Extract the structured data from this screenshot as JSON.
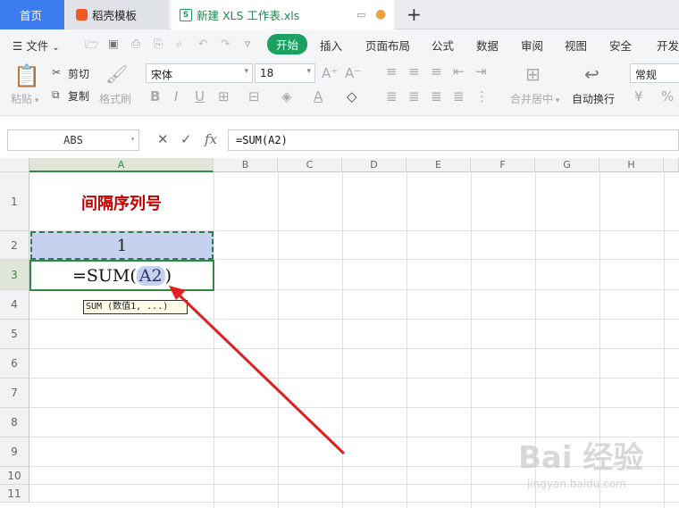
{
  "tabs": {
    "home": "首页",
    "docer": "稻壳模板",
    "doc": "新建 XLS 工作表.xls",
    "add_icon": "plus-icon",
    "xls_logo": "S"
  },
  "menu": {
    "file": "文件",
    "items": [
      "开始",
      "插入",
      "页面布局",
      "公式",
      "数据",
      "审阅",
      "视图",
      "安全",
      "开发"
    ]
  },
  "ribbon": {
    "paste": "粘贴",
    "cut": "剪切",
    "copy": "复制",
    "format_painter": "格式刷",
    "font_name": "宋体",
    "font_size": "18",
    "merge_center": "合并居中",
    "wrap_text": "自动换行",
    "number_format": "常规"
  },
  "formula_bar": {
    "name_box": "ABS",
    "fx": "fx",
    "formula": "=SUM(A2)"
  },
  "sheet": {
    "columns": [
      "A",
      "B",
      "C",
      "D",
      "E",
      "F",
      "G",
      "H"
    ],
    "rows": [
      "1",
      "2",
      "3",
      "4",
      "5",
      "6",
      "7",
      "8",
      "9",
      "10",
      "11"
    ],
    "a1": "间隔序列号",
    "a2": "1",
    "a3_prefix": "=SUM(",
    "a3_ref": "A2",
    "a3_suffix": ")",
    "tooltip": "SUM (数值1, ...)"
  },
  "colors": {
    "accent": "#1aa061",
    "home_tab": "#3b7cf0",
    "title_red": "#c00000",
    "selection": "#c5d1ee",
    "arrow": "#e02020"
  },
  "watermark": {
    "text": "Bai 经验",
    "sub": "jingyan.baidu.com"
  }
}
